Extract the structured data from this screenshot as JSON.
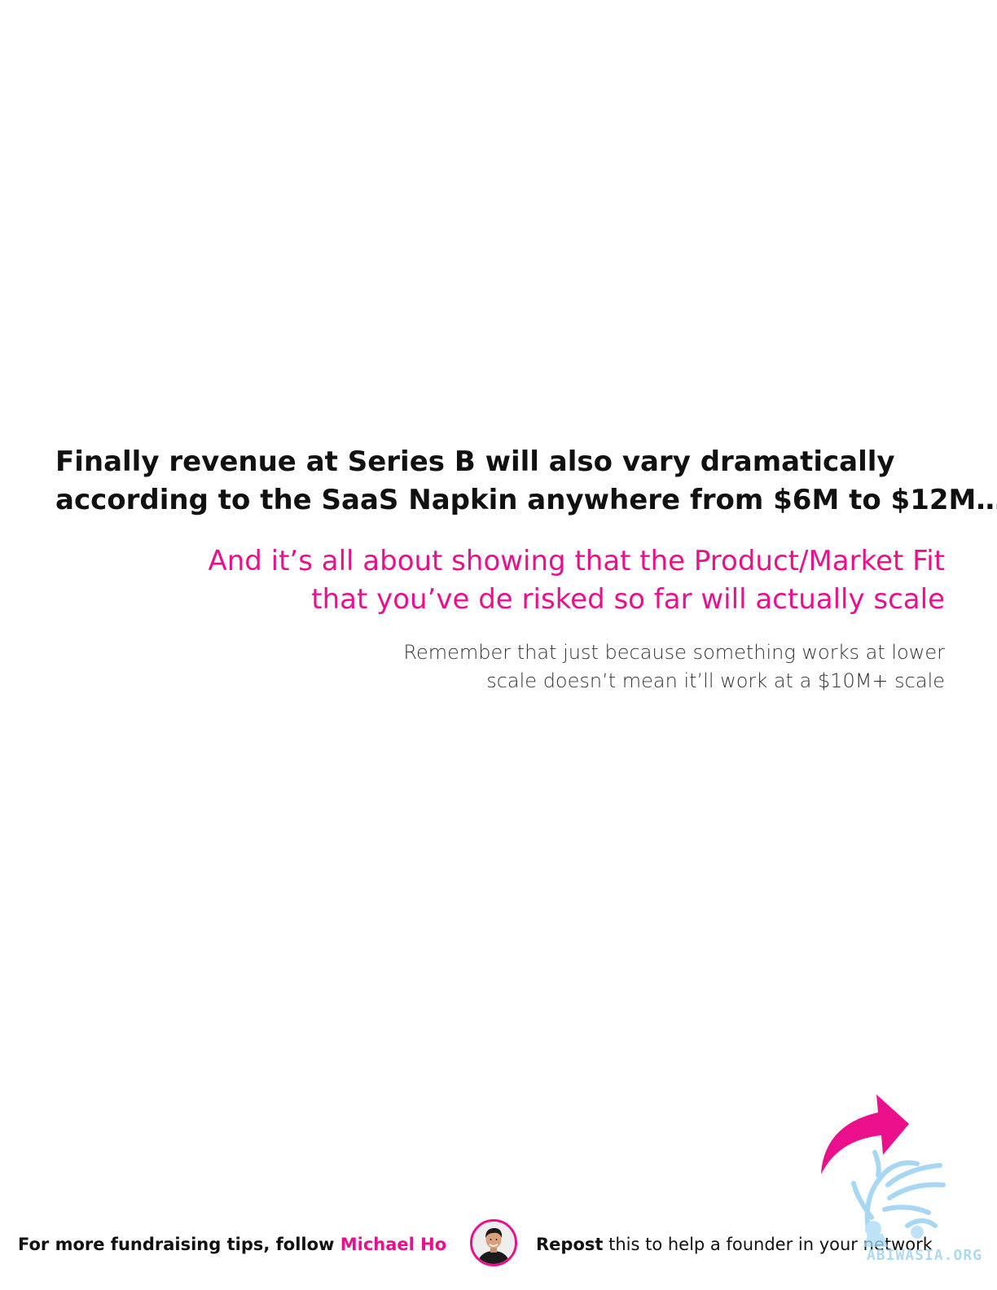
{
  "headline": {
    "line1": "Finally revenue at Series B will also vary dramatically",
    "line2": "according to the SaaS Napkin anywhere from $6M to $12M…"
  },
  "subheadline": {
    "line1": "And it’s all about showing that the Product/Market Fit",
    "line2": "that you’ve de risked so far will actually scale"
  },
  "note": {
    "line1": "Remember that just because something works at lower",
    "line2": "scale doesn’t mean it’ll work at a $10M+ scale"
  },
  "footer": {
    "follow_prefix": "For more fundraising tips, follow ",
    "author_name": "Michael Ho",
    "repost_word": "Repost",
    "repost_rest": " this to help a founder in your network"
  },
  "watermark": {
    "text": "ABIWASIA.ORG"
  },
  "colors": {
    "accent": "#ec0f8c",
    "text": "#111111",
    "watermark": "#9fd3f0"
  },
  "icons": {
    "share": "share-arrow-icon",
    "avatar": "author-avatar"
  }
}
